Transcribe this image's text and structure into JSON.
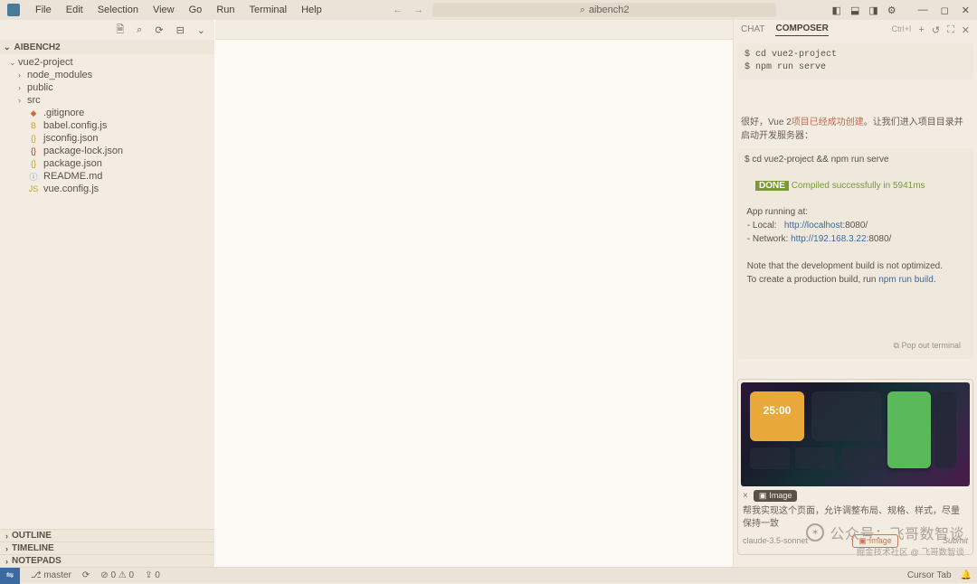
{
  "menu": [
    "File",
    "Edit",
    "Selection",
    "View",
    "Go",
    "Run",
    "Terminal",
    "Help"
  ],
  "search_placeholder": "aibench2",
  "layout_icons": [
    "primary-sidebar",
    "panel",
    "secondary-sidebar",
    "settings"
  ],
  "window_controls": [
    "minimize",
    "maximize",
    "close"
  ],
  "sidebar": {
    "toolbar_icons": [
      "new-file",
      "search",
      "refresh",
      "collapse",
      "more"
    ],
    "title": "AIBENCH2",
    "tree": [
      {
        "depth": 1,
        "kind": "folder-open",
        "name": "vue2-project"
      },
      {
        "depth": 2,
        "kind": "folder",
        "name": "node_modules"
      },
      {
        "depth": 2,
        "kind": "folder",
        "name": "public"
      },
      {
        "depth": 2,
        "kind": "folder",
        "name": "src"
      },
      {
        "depth": 2,
        "kind": "git",
        "name": ".gitignore"
      },
      {
        "depth": 2,
        "kind": "babel",
        "name": "babel.config.js"
      },
      {
        "depth": 2,
        "kind": "json",
        "name": "jsconfig.json"
      },
      {
        "depth": 2,
        "kind": "lock",
        "name": "package-lock.json"
      },
      {
        "depth": 2,
        "kind": "json",
        "name": "package.json"
      },
      {
        "depth": 2,
        "kind": "md",
        "name": "README.md"
      },
      {
        "depth": 2,
        "kind": "js",
        "name": "vue.config.js"
      }
    ],
    "sections": [
      "OUTLINE",
      "TIMELINE",
      "NOTEPADS"
    ]
  },
  "rightpanel": {
    "tabs": {
      "chat": "CHAT",
      "composer": "COMPOSER"
    },
    "shortcut": "Ctrl+I",
    "action_icons": [
      "add",
      "history",
      "expand",
      "close"
    ],
    "block1": "$ cd vue2-project\n$ npm run serve",
    "assistant_msg_pre": "很好，Vue 2",
    "assistant_msg_hl": "项目已经成功创建",
    "assistant_msg_post": "。让我们进入项目目录并启动开发服务器：",
    "block2_cmd": "$ cd vue2-project && npm run serve",
    "block2_done": "DONE",
    "block2_compiled": " Compiled successfully in 5941ms",
    "block2_running": " App running at:\n - Local:   ",
    "block2_local_url": "http://localhost:",
    "block2_local_port": "8080/",
    "block2_net_label": "\n - Network: ",
    "block2_net_url": "http://192.168.3.22:",
    "block2_net_port": "8080/",
    "block2_note1": "\n\n Note that the development build is not optimized.\n To create a production build, run ",
    "block2_npm": "npm run build",
    "block2_dot": ".",
    "popout": "Pop out terminal",
    "preview_time": "25:00",
    "image_chip": "Image",
    "prompt": "帮我实现这个页面，允许调整布局、规格、样式，尽量保持一致",
    "model_label": "claude-3.5-sonnet",
    "image_attach": "Image",
    "submit": "Submit"
  },
  "statusbar": {
    "branch": "master",
    "sync": "",
    "errors": "0",
    "warnings": "0",
    "ports": "0",
    "cursor_tab": "Cursor Tab"
  },
  "watermark": {
    "main": "公众号：飞哥数智谈",
    "sub": "掘金技术社区 @ 飞哥数智谈"
  }
}
